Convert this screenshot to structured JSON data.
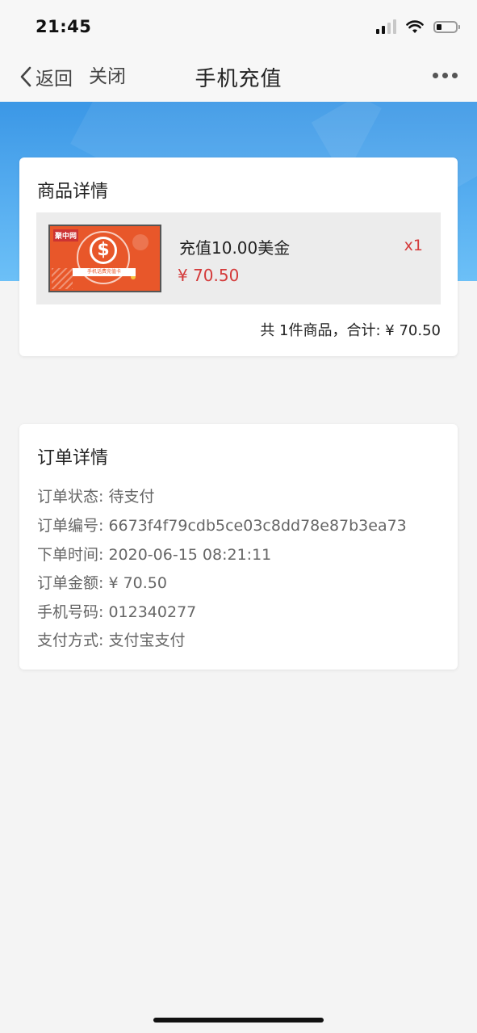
{
  "status_bar": {
    "time": "21:45"
  },
  "nav": {
    "back_label": "返回",
    "close_label": "关闭",
    "title": "手机充值"
  },
  "product_card": {
    "title": "商品详情",
    "item": {
      "name": "充值10.00美金",
      "price": "¥ 70.50",
      "quantity": "x1",
      "image_icon": "dollar-coin-icon"
    },
    "summary": "共 1件商品，合计: ¥ 70.50"
  },
  "order_card": {
    "title": "订单详情",
    "rows": [
      {
        "label": "订单状态:",
        "value": "待支付"
      },
      {
        "label": "订单编号:",
        "value": "6673f4f79cdb5ce03c8dd78e87b3ea73"
      },
      {
        "label": "下单时间:",
        "value": "2020-06-15 08:21:11"
      },
      {
        "label": "订单金额:",
        "value": "¥ 70.50"
      },
      {
        "label": "手机号码:",
        "value": "012340277"
      },
      {
        "label": "支付方式:",
        "value": "支付宝支付"
      }
    ]
  },
  "colors": {
    "banner_blue": "#3b97e6",
    "price_red": "#d43a3a",
    "thumb_orange": "#e8572a"
  }
}
